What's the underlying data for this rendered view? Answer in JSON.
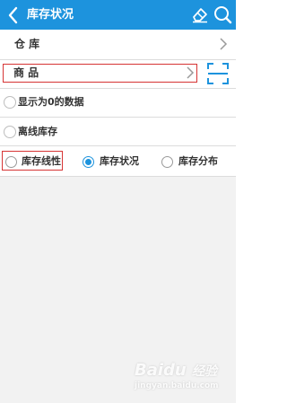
{
  "header": {
    "title": "库存状况",
    "bg_color": "#1d93dd"
  },
  "fields": {
    "warehouse_label": "仓  库",
    "goods_label": "商  品"
  },
  "checkboxes": [
    {
      "label": "显示为0的数据",
      "checked": false
    },
    {
      "label": "离线库存",
      "checked": false
    }
  ],
  "radios": [
    {
      "label": "库存线性",
      "selected": false
    },
    {
      "label": "库存状况",
      "selected": true
    },
    {
      "label": "库存分布",
      "selected": false
    }
  ],
  "watermark": {
    "brand": "Baidu",
    "sub": "经验",
    "url": "jingyan.baidu.com"
  },
  "icons": [
    "back-arrow-icon",
    "eraser-icon",
    "search-icon",
    "chevron-right-icon",
    "scan-icon"
  ],
  "colors": {
    "accent": "#1d93dd",
    "highlight": "#d63434"
  }
}
